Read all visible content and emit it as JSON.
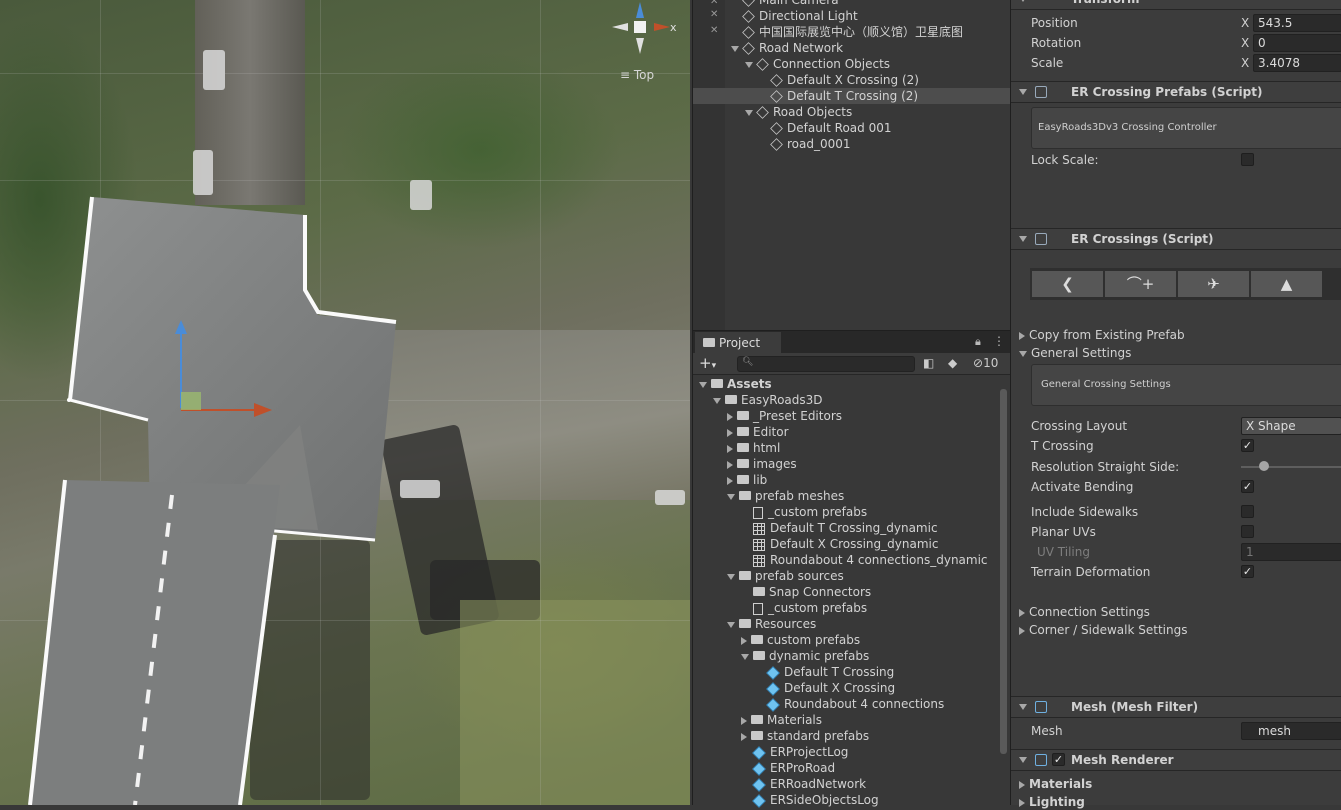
{
  "scene": {
    "orientation_label": "Top",
    "gizmo_axis_label": "x"
  },
  "hierarchy": {
    "rows": [
      {
        "label": "Main Camera",
        "indent": 1,
        "icon": "cube-icon",
        "fold": "none",
        "selected": false
      },
      {
        "label": "Directional Light",
        "indent": 1,
        "icon": "cube-icon",
        "fold": "none",
        "selected": false
      },
      {
        "label": "中国国际展览中心（顺义馆）卫星底图",
        "indent": 1,
        "icon": "cube-icon",
        "fold": "none",
        "selected": false
      },
      {
        "label": "Road Network",
        "indent": 1,
        "icon": "cube-icon",
        "fold": "open",
        "selected": false
      },
      {
        "label": "Connection Objects",
        "indent": 2,
        "icon": "cube-icon",
        "fold": "open",
        "selected": false
      },
      {
        "label": "Default X Crossing (2)",
        "indent": 3,
        "icon": "cube-icon",
        "fold": "none",
        "selected": false
      },
      {
        "label": "Default T Crossing (2)",
        "indent": 3,
        "icon": "cube-icon",
        "fold": "none",
        "selected": true
      },
      {
        "label": "Road Objects",
        "indent": 2,
        "icon": "cube-icon",
        "fold": "open",
        "selected": false
      },
      {
        "label": "Default Road 001",
        "indent": 3,
        "icon": "cube-icon",
        "fold": "none",
        "selected": false
      },
      {
        "label": "road_0001",
        "indent": 3,
        "icon": "cube-icon",
        "fold": "none",
        "selected": false
      }
    ]
  },
  "project": {
    "tab_label": "Project",
    "search_placeholder": "",
    "hidden_count": "10",
    "rows": [
      {
        "label": "Assets",
        "indent": 0,
        "icon": "folder-icon",
        "fold": "open",
        "bold": true
      },
      {
        "label": "EasyRoads3D",
        "indent": 1,
        "icon": "folder-icon",
        "fold": "open"
      },
      {
        "label": "_Preset Editors",
        "indent": 2,
        "icon": "folder-icon",
        "fold": "closed"
      },
      {
        "label": "Editor",
        "indent": 2,
        "icon": "folder-icon",
        "fold": "closed"
      },
      {
        "label": "html",
        "indent": 2,
        "icon": "folder-icon",
        "fold": "closed"
      },
      {
        "label": "images",
        "indent": 2,
        "icon": "folder-icon",
        "fold": "closed"
      },
      {
        "label": "lib",
        "indent": 2,
        "icon": "folder-icon",
        "fold": "closed"
      },
      {
        "label": "prefab meshes",
        "indent": 2,
        "icon": "folder-icon",
        "fold": "open"
      },
      {
        "label": "_custom prefabs",
        "indent": 3,
        "icon": "file-icon",
        "fold": "none"
      },
      {
        "label": "Default T Crossing_dynamic",
        "indent": 3,
        "icon": "mesh-icon",
        "fold": "none"
      },
      {
        "label": "Default X Crossing_dynamic",
        "indent": 3,
        "icon": "mesh-icon",
        "fold": "none"
      },
      {
        "label": "Roundabout 4 connections_dynamic",
        "indent": 3,
        "icon": "mesh-icon",
        "fold": "none"
      },
      {
        "label": "prefab sources",
        "indent": 2,
        "icon": "folder-icon",
        "fold": "open"
      },
      {
        "label": "Snap Connectors",
        "indent": 3,
        "icon": "folder-icon",
        "fold": "none"
      },
      {
        "label": "_custom prefabs",
        "indent": 3,
        "icon": "file-icon",
        "fold": "none"
      },
      {
        "label": "Resources",
        "indent": 2,
        "icon": "folder-icon",
        "fold": "open"
      },
      {
        "label": "custom prefabs",
        "indent": 3,
        "icon": "folder-icon",
        "fold": "closed"
      },
      {
        "label": "dynamic prefabs",
        "indent": 3,
        "icon": "folder-icon",
        "fold": "open"
      },
      {
        "label": "Default T Crossing",
        "indent": 4,
        "icon": "prefab-icon",
        "fold": "none"
      },
      {
        "label": "Default X Crossing",
        "indent": 4,
        "icon": "prefab-icon",
        "fold": "none"
      },
      {
        "label": "Roundabout 4 connections",
        "indent": 4,
        "icon": "prefab-icon",
        "fold": "none"
      },
      {
        "label": "Materials",
        "indent": 3,
        "icon": "folder-icon",
        "fold": "closed"
      },
      {
        "label": "standard prefabs",
        "indent": 3,
        "icon": "folder-icon",
        "fold": "closed"
      },
      {
        "label": "ERProjectLog",
        "indent": 3,
        "icon": "prefab-icon",
        "fold": "none"
      },
      {
        "label": "ERProRoad",
        "indent": 3,
        "icon": "prefab-icon",
        "fold": "none"
      },
      {
        "label": "ERRoadNetwork",
        "indent": 3,
        "icon": "prefab-icon",
        "fold": "none"
      },
      {
        "label": "ERSideObjectsLog",
        "indent": 3,
        "icon": "prefab-icon",
        "fold": "none"
      }
    ]
  },
  "inspector": {
    "transform": {
      "title": "Transform",
      "position_label": "Position",
      "rotation_label": "Rotation",
      "scale_label": "Scale",
      "axis": "X",
      "position_x": "543.5",
      "rotation_x": "0",
      "scale_x": "3.4078"
    },
    "crossing_prefabs": {
      "title": "ER Crossing Prefabs (Script)",
      "box_text": "EasyRoads3Dv3 Crossing Controller",
      "lock_scale_label": "Lock Scale:"
    },
    "crossings": {
      "title": "ER Crossings (Script)",
      "toolbar_icons": [
        "back-arrow-icon",
        "add-road-icon",
        "crossing-icon",
        "terrain-icon"
      ],
      "copy_label": "Copy from Existing Prefab",
      "general_label": "General Settings",
      "general_box": "General Crossing Settings",
      "crossing_layout_label": "Crossing Layout",
      "crossing_layout_value": "X Shape",
      "t_crossing_label": "T Crossing",
      "resolution_label": "Resolution Straight Side:",
      "resolution_slider_fraction": 0.2,
      "activate_bending_label": "Activate Bending",
      "include_sidewalks_label": "Include Sidewalks",
      "planar_uvs_label": "Planar UVs",
      "uv_tiling_label": "UV Tiling",
      "uv_tiling_value": "1",
      "terrain_deformation_label": "Terrain Deformation",
      "connection_settings_label": "Connection Settings",
      "corner_settings_label": "Corner / Sidewalk Settings"
    },
    "mesh_filter": {
      "title": "Mesh (Mesh Filter)",
      "mesh_label": "Mesh",
      "mesh_value": "mesh"
    },
    "mesh_renderer": {
      "title": "Mesh Renderer",
      "materials_label": "Materials",
      "lighting_label": "Lighting"
    }
  }
}
